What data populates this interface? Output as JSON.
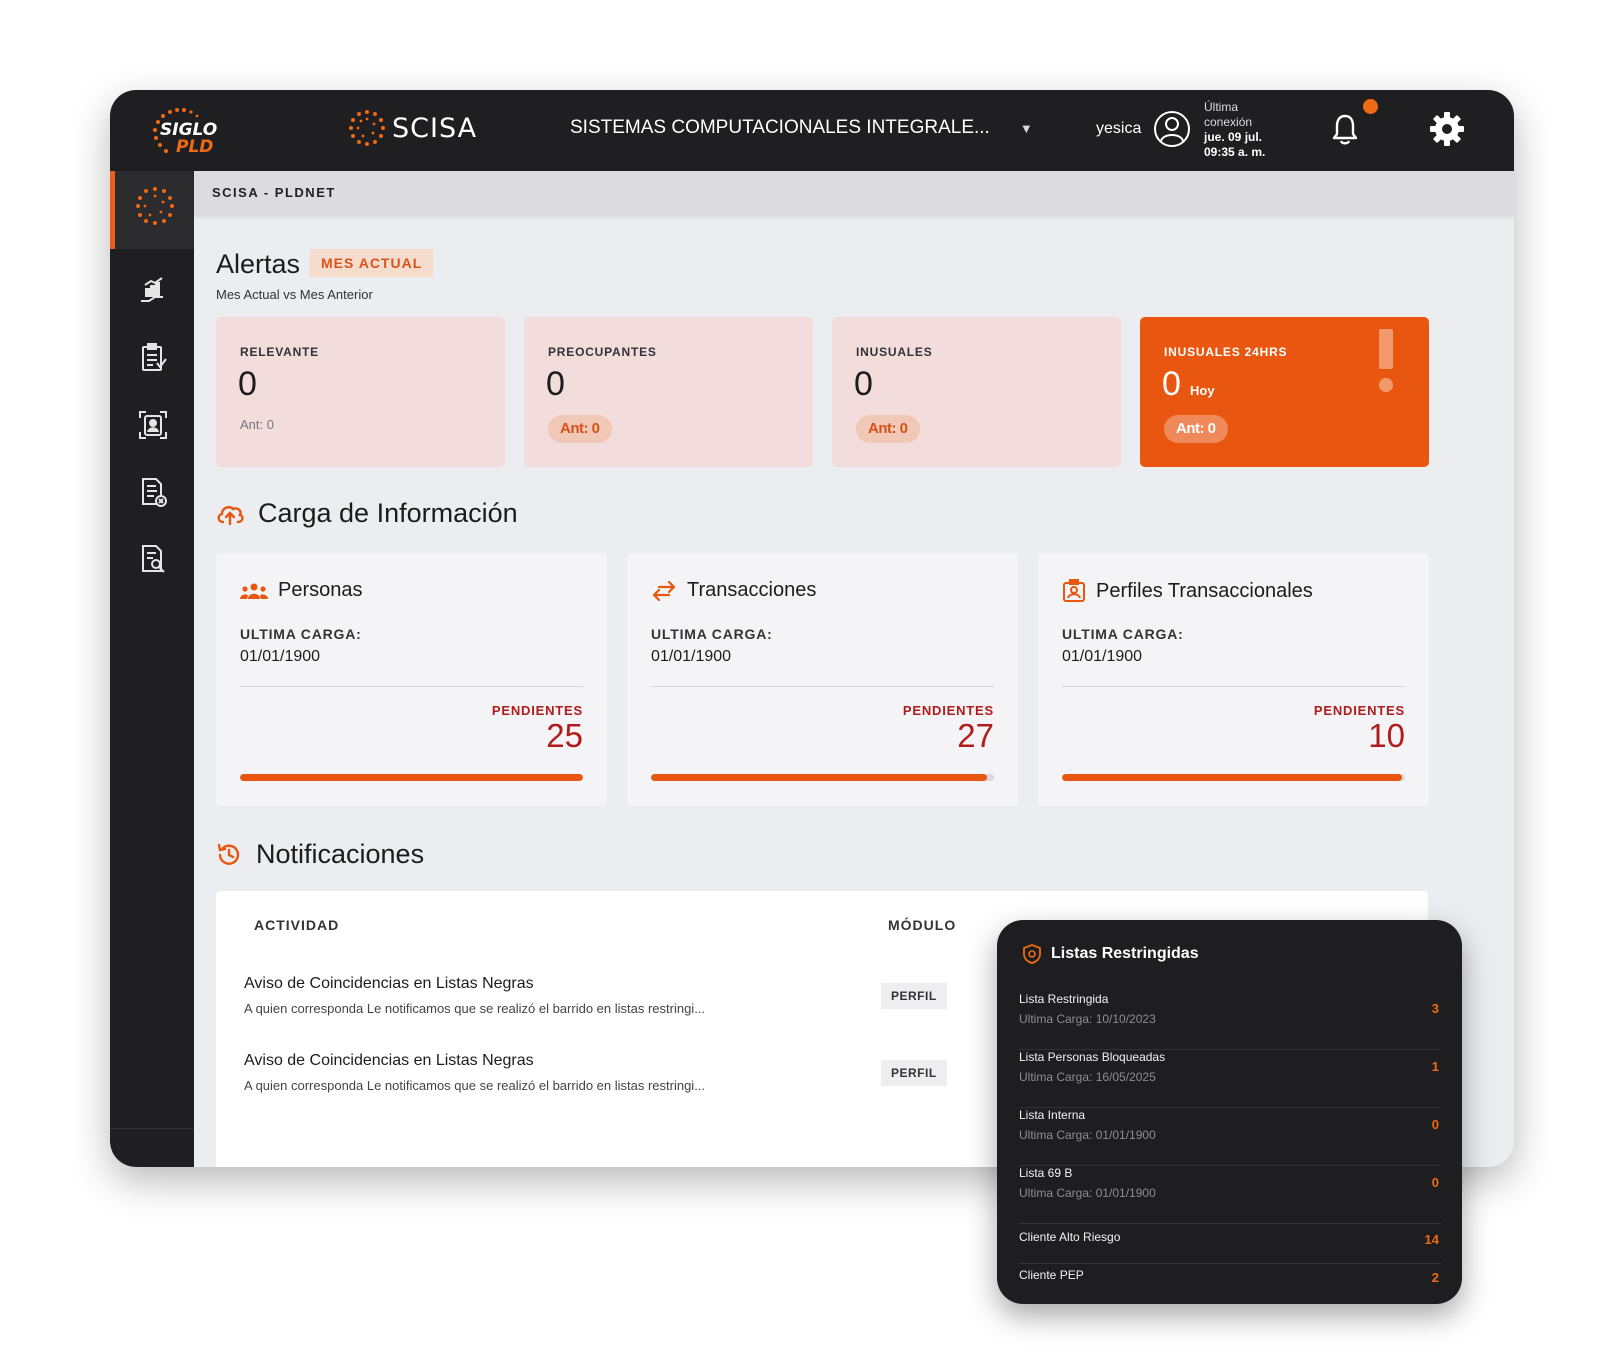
{
  "header": {
    "logo_left": "SIGLO PLD",
    "logo_scisa": "SCISA",
    "company": "SISTEMAS COMPUTACIONALES INTEGRALE...",
    "user": "yesica",
    "last_conn_label_1": "Última",
    "last_conn_label_2": "conexión",
    "last_conn_date": "jue. 09 jul.",
    "last_conn_time": "09:35 a. m.",
    "icons": {
      "bell": "bell-icon",
      "gear": "gear-icon",
      "avatar": "user-avatar-icon",
      "dropdown": "caret-down-icon"
    },
    "notification_dot_color": "#ef6a14"
  },
  "breadcrumb": "SCISA - PLDNET",
  "sidebar": {
    "items": [
      {
        "icon": "scisa-logo-icon",
        "active": true
      },
      {
        "icon": "analytics-hand-icon"
      },
      {
        "icon": "clipboard-check-icon"
      },
      {
        "icon": "profile-id-icon"
      },
      {
        "icon": "document-x-icon"
      },
      {
        "icon": "document-search-icon"
      }
    ]
  },
  "alerts": {
    "title": "Alertas",
    "badge": "MES ACTUAL",
    "subtitle": "Mes Actual vs Mes Anterior",
    "cards": [
      {
        "label": "RELEVANTE",
        "value": "0",
        "ant": "Ant: 0"
      },
      {
        "label": "PREOCUPANTES",
        "value": "0",
        "ant": "Ant: 0"
      },
      {
        "label": "INUSUALES",
        "value": "0",
        "ant": "Ant: 0"
      },
      {
        "label": "INUSUALES 24HRS",
        "value": "0",
        "suffix": "Hoy",
        "ant": "Ant: 0"
      }
    ]
  },
  "carga": {
    "title": "Carga de Información",
    "icon": "cloud-upload-icon",
    "cards": [
      {
        "title": "Personas",
        "icon": "people-icon",
        "uc_label": "ULTIMA CARGA:",
        "date": "01/01/1900",
        "pend_label": "PENDIENTES",
        "pend": "25",
        "progress": 1.0
      },
      {
        "title": "Transacciones",
        "icon": "arrows-exchange-icon",
        "uc_label": "ULTIMA CARGA:",
        "date": "01/01/1900",
        "pend_label": "PENDIENTES",
        "pend": "27",
        "progress": 0.98
      },
      {
        "title": "Perfiles Transaccionales",
        "icon": "profile-badge-icon",
        "uc_label": "ULTIMA CARGA:",
        "date": "01/01/1900",
        "pend_label": "PENDIENTES",
        "pend": "10",
        "progress": 0.99
      }
    ]
  },
  "notificaciones": {
    "title": "Notificaciones",
    "icon": "history-icon",
    "col_actividad": "ACTIVIDAD",
    "col_modulo": "MÓDULO",
    "rows": [
      {
        "title": "Aviso de Coincidencias en Listas Negras",
        "desc": "A quien corresponda Le notificamos que se realizó el barrido en listas restringi...",
        "module": "PERFIL"
      },
      {
        "title": "Aviso de Coincidencias en Listas Negras",
        "desc": "A quien corresponda Le notificamos que se realizó el barrido en listas restringi...",
        "module": "PERFIL"
      }
    ]
  },
  "listas": {
    "title": "Listas Restringidas",
    "icon": "shield-at-icon",
    "items": [
      {
        "name": "Lista Restringida",
        "sub": "Ultima Carga: 10/10/2023",
        "count": "3"
      },
      {
        "name": "Lista Personas Bloqueadas",
        "sub": "Ultima Carga: 16/05/2025",
        "count": "1"
      },
      {
        "name": "Lista Interna",
        "sub": "Ultima Carga: 01/01/1900",
        "count": "0"
      },
      {
        "name": "Lista 69 B",
        "sub": "Ultima Carga: 01/01/1900",
        "count": "0"
      },
      {
        "name": "Cliente Alto Riesgo",
        "sub": "",
        "count": "14"
      },
      {
        "name": "Cliente PEP",
        "sub": "",
        "count": "2"
      }
    ]
  },
  "colors": {
    "accent": "#e8560f",
    "danger": "#b11b1b",
    "dark": "#1f1f21",
    "alert_bg": "#f3dcdc"
  }
}
